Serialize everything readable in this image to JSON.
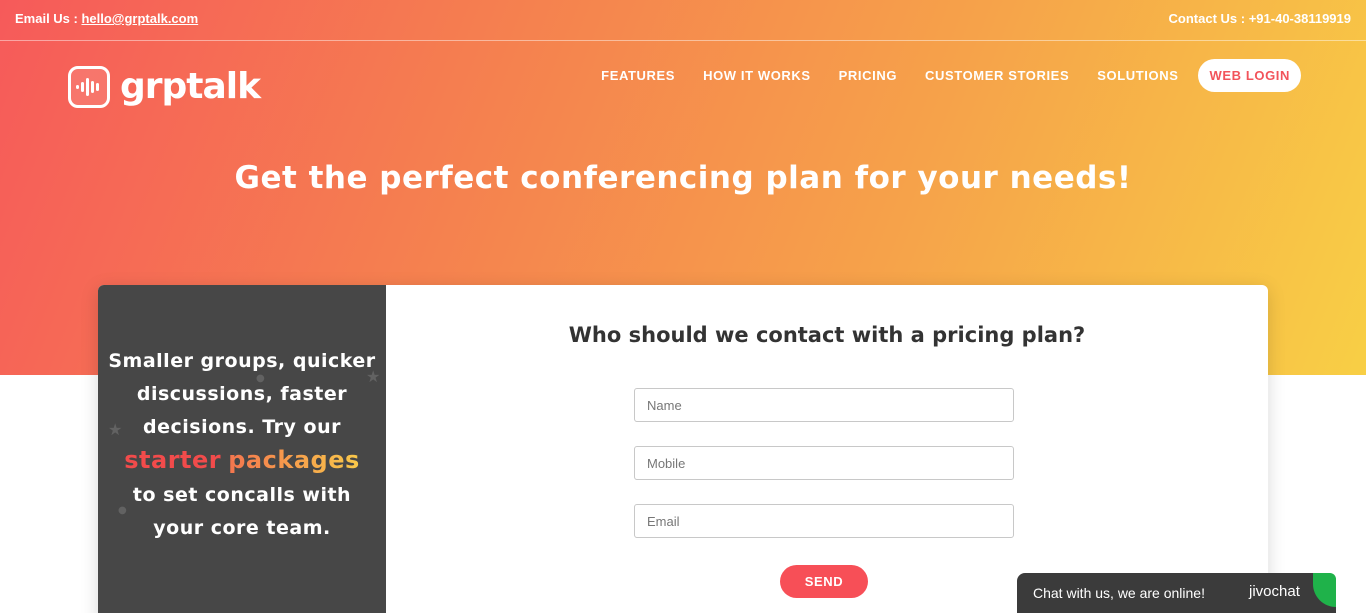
{
  "topbar": {
    "email_label": "Email Us : ",
    "email_value": "hello@grptalk.com",
    "contact": "Contact Us : +91-40-38119919"
  },
  "brand": {
    "name": "grptalk"
  },
  "nav": {
    "items": [
      {
        "label": "FEATURES"
      },
      {
        "label": "HOW IT WORKS"
      },
      {
        "label": "PRICING"
      },
      {
        "label": "CUSTOMER STORIES"
      },
      {
        "label": "SOLUTIONS"
      }
    ],
    "login": "WEB LOGIN"
  },
  "hero": {
    "headline": "Get the perfect conferencing plan for your needs!"
  },
  "promo": {
    "line1": "Smaller groups, quicker",
    "line2": "discussions, faster",
    "line3": "decisions. Try our",
    "highlight1": "starter",
    "highlight2": "packages",
    "line5": "to set concalls with",
    "line6": "your core team."
  },
  "form": {
    "title": "Who should we contact with a pricing plan?",
    "name_placeholder": "Name",
    "mobile_placeholder": "Mobile",
    "email_placeholder": "Email",
    "send": "SEND"
  },
  "chat": {
    "text": "Chat with us, we are online!",
    "brand": "jivochat"
  },
  "colors": {
    "accent": "#f74f57",
    "gradient_start": "#f65a5a",
    "gradient_end": "#f8cf45",
    "panel_dark": "#474747"
  }
}
